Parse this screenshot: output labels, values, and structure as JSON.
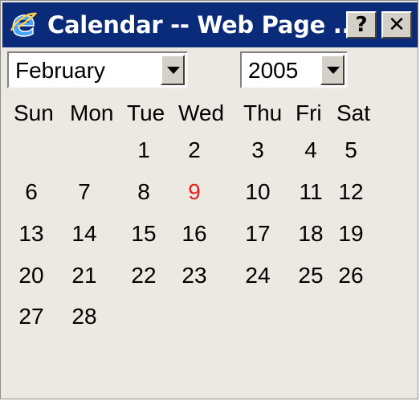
{
  "window": {
    "title": "Calendar -- Web Page ...",
    "help_label": "?",
    "close_label": "✕",
    "icon": "internet-explorer-icon",
    "titlebar_color": "#0a2a7a"
  },
  "controls": {
    "month": "February",
    "year": "2005"
  },
  "calendar": {
    "weekdays": [
      "Sun",
      "Mon",
      "Tue",
      "Wed",
      "Thu",
      "Fri",
      "Sat"
    ],
    "highlight_color": "#e02020",
    "today": "9",
    "weeks": [
      [
        "",
        "",
        "1",
        "2",
        "3",
        "4",
        "5"
      ],
      [
        "6",
        "7",
        "8",
        "9",
        "10",
        "11",
        "12"
      ],
      [
        "13",
        "14",
        "15",
        "16",
        "17",
        "18",
        "19"
      ],
      [
        "20",
        "21",
        "22",
        "23",
        "24",
        "25",
        "26"
      ],
      [
        "27",
        "28",
        "",
        "",
        "",
        "",
        ""
      ]
    ]
  }
}
